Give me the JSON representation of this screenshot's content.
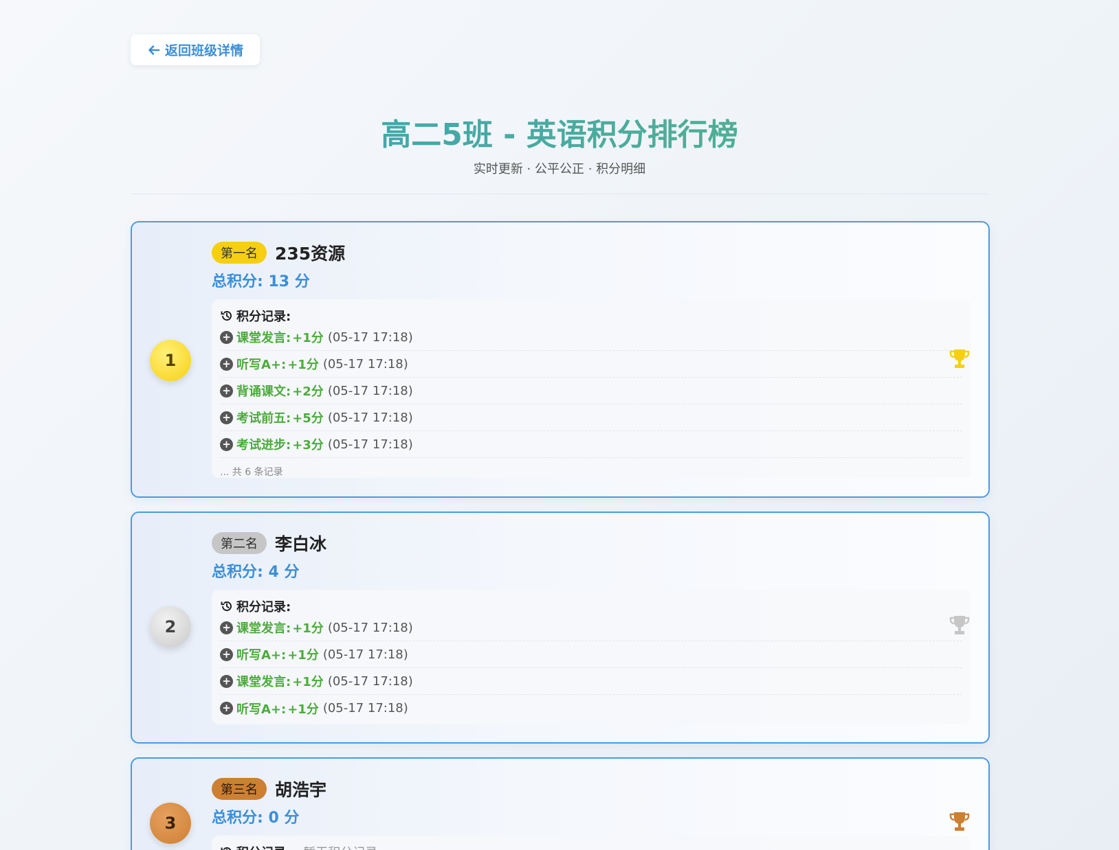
{
  "back_button": {
    "label": "返回班级详情",
    "icon": "arrow-left-icon"
  },
  "header": {
    "title": "高二5班 - 英语积分排行榜",
    "subtitle": "实时更新 · 公平公正 · 积分明细"
  },
  "labels": {
    "records_title": "积分记录:"
  },
  "colors": {
    "gold": "#f7cf12",
    "silver": "#c6c6c6",
    "bronze": "#cd7f32",
    "accent": "#3a8fd9",
    "points": "#4cab3c"
  },
  "ranking": [
    {
      "rank": "1",
      "badge": "第一名",
      "name": "235资源",
      "total": "总积分: 13 分",
      "records": [
        {
          "reason": "课堂发言:",
          "points": "+1分",
          "time": "(05-17 17:18)"
        },
        {
          "reason": "听写A+:",
          "points": "+1分",
          "time": "(05-17 17:18)"
        },
        {
          "reason": "背诵课文:",
          "points": "+2分",
          "time": "(05-17 17:18)"
        },
        {
          "reason": "考试前五:",
          "points": "+5分",
          "time": "(05-17 17:18)"
        },
        {
          "reason": "考试进步:",
          "points": "+3分",
          "time": "(05-17 17:18)"
        }
      ],
      "more": "... 共 6 条记录"
    },
    {
      "rank": "2",
      "badge": "第二名",
      "name": "李白冰",
      "total": "总积分: 4 分",
      "records": [
        {
          "reason": "课堂发言:",
          "points": "+1分",
          "time": "(05-17 17:18)"
        },
        {
          "reason": "听写A+:",
          "points": "+1分",
          "time": "(05-17 17:18)"
        },
        {
          "reason": "课堂发言:",
          "points": "+1分",
          "time": "(05-17 17:18)"
        },
        {
          "reason": "听写A+:",
          "points": "+1分",
          "time": "(05-17 17:18)"
        }
      ]
    },
    {
      "rank": "3",
      "badge": "第三名",
      "name": "胡浩宇",
      "total": "总积分: 0 分",
      "records_empty": "暂无积分记录"
    }
  ]
}
